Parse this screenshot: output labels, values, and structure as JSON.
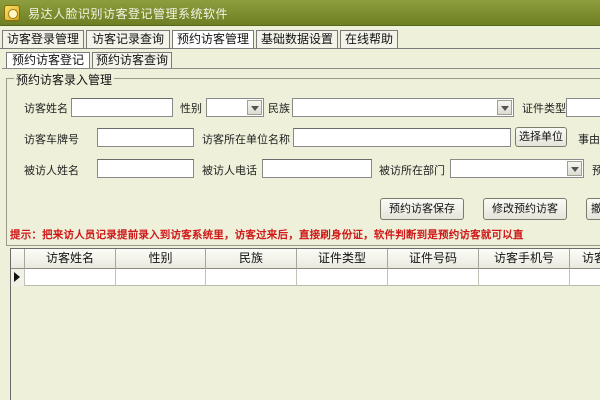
{
  "window": {
    "title": "易达人脸识别访客登记管理系统软件"
  },
  "main_tabs": [
    {
      "label": "访客登录管理",
      "active": false
    },
    {
      "label": "访客记录查询",
      "active": false
    },
    {
      "label": "预约访客管理",
      "active": true
    },
    {
      "label": "基础数据设置",
      "active": false
    },
    {
      "label": "在线帮助",
      "active": false
    }
  ],
  "sub_tabs": [
    {
      "label": "预约访客登记",
      "active": true
    },
    {
      "label": "预约访客查询",
      "active": false
    }
  ],
  "group": {
    "title": "预约访客录入管理"
  },
  "form": {
    "visitor_name_label": "访客姓名",
    "gender_label": "性别",
    "ethnicity_label": "民族",
    "id_type_label": "证件类型",
    "plate_label": "访客车牌号",
    "company_label": "访客所在单位名称",
    "select_company_button": "选择单位",
    "reason_label": "事由",
    "host_name_label": "被访人姓名",
    "host_phone_label": "被访人电话",
    "host_dept_label": "被访所在部门",
    "extra_label": "预",
    "visitor_name": "",
    "plate": "",
    "company": "",
    "host_name": "",
    "host_phone": ""
  },
  "buttons": {
    "save": "预约访客保存",
    "edit": "修改预约访客",
    "third": "撤"
  },
  "hint": "提示：把来访人员记录提前录入到访客系统里，访客过来后，直接刷身份证，软件判断到是预约访客就可以直",
  "grid": {
    "columns": [
      "访客姓名",
      "性别",
      "民族",
      "证件类型",
      "证件号码",
      "访客手机号",
      "访客"
    ],
    "rows": [
      [
        "",
        "",
        "",
        "",
        "",
        "",
        ""
      ]
    ]
  }
}
